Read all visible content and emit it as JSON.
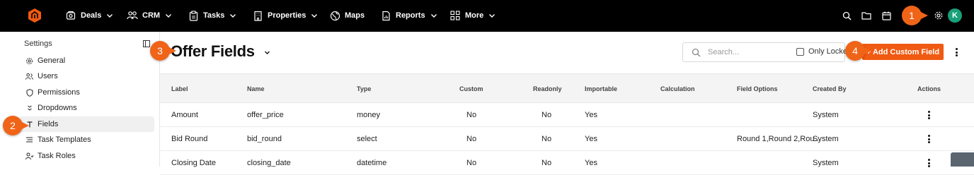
{
  "topbar": {
    "nav": [
      {
        "label": "Deals",
        "icon": "deals-icon",
        "has_menu": true
      },
      {
        "label": "CRM",
        "icon": "people-icon",
        "has_menu": true
      },
      {
        "label": "Tasks",
        "icon": "clipboard-icon",
        "has_menu": true
      },
      {
        "label": "Properties",
        "icon": "building-icon",
        "has_menu": true
      },
      {
        "label": "Maps",
        "icon": "globe-icon",
        "has_menu": false
      },
      {
        "label": "Reports",
        "icon": "report-icon",
        "has_menu": true
      },
      {
        "label": "More",
        "icon": "grid-icon",
        "has_menu": true
      }
    ],
    "avatar_initial": "K"
  },
  "sidebar": {
    "title": "Settings",
    "items": [
      {
        "label": "General",
        "icon": "gear-icon"
      },
      {
        "label": "Users",
        "icon": "users-icon"
      },
      {
        "label": "Permissions",
        "icon": "shield-icon"
      },
      {
        "label": "Dropdowns",
        "icon": "dropdown-icon"
      },
      {
        "label": "Fields",
        "icon": "fields-icon",
        "active": true
      },
      {
        "label": "Task Templates",
        "icon": "list-icon"
      },
      {
        "label": "Task Roles",
        "icon": "role-icon"
      }
    ]
  },
  "header": {
    "title": "Offer Fields",
    "search_placeholder": "Search...",
    "only_locked_label": "Only Locked",
    "add_button_label": "+ Add Custom Field"
  },
  "table": {
    "columns": [
      "Label",
      "Name",
      "Type",
      "Custom",
      "Readonly",
      "Importable",
      "Calculation",
      "Field Options",
      "Created By",
      "Actions"
    ],
    "rows": [
      {
        "label": "Amount",
        "name": "offer_price",
        "type": "money",
        "custom": "No",
        "readonly": "No",
        "importable": "Yes",
        "calculation": "",
        "field_options": "",
        "created_by": "System"
      },
      {
        "label": "Bid Round",
        "name": "bid_round",
        "type": "select",
        "custom": "No",
        "readonly": "No",
        "importable": "Yes",
        "calculation": "",
        "field_options": "Round 1,Round 2,Rou...",
        "created_by": "System"
      },
      {
        "label": "Closing Date",
        "name": "closing_date",
        "type": "datetime",
        "custom": "No",
        "readonly": "No",
        "importable": "Yes",
        "calculation": "",
        "field_options": "",
        "created_by": "System"
      }
    ]
  },
  "callouts": [
    "1",
    "2",
    "3",
    "4"
  ],
  "colors": {
    "accent": "#f05a12",
    "topbar": "#000000",
    "avatar": "#18a07a",
    "callout": "#f06418"
  }
}
